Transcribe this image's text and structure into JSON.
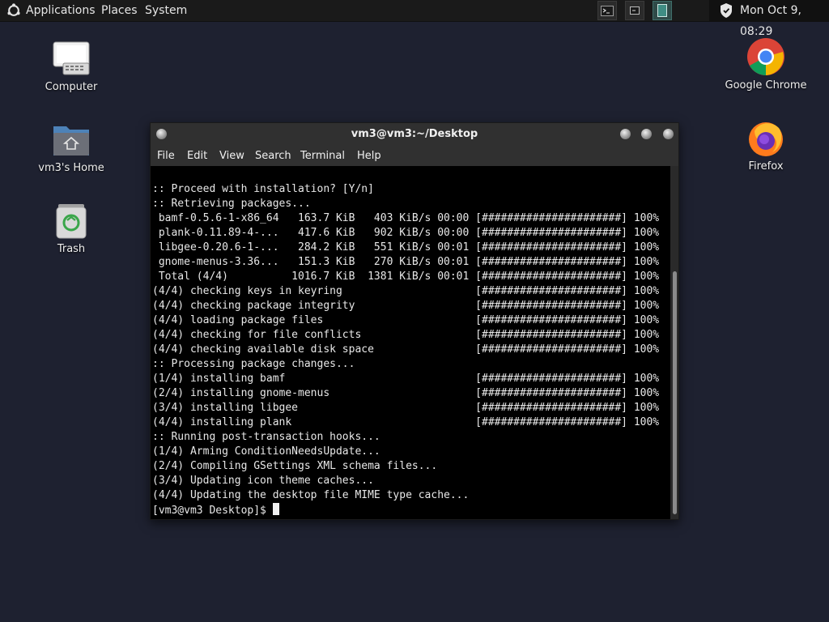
{
  "panel": {
    "applications": "Applications",
    "places": "Places",
    "system": "System",
    "clock": "Mon Oct  9, 08:29"
  },
  "desktop_icons": {
    "computer": "Computer",
    "home": "vm3's Home",
    "trash": "Trash",
    "chrome": "Google Chrome",
    "firefox": "Firefox"
  },
  "terminal": {
    "title": "vm3@vm3:~/Desktop",
    "menu": {
      "file": "File",
      "edit": "Edit",
      "view": "View",
      "search": "Search",
      "terminal": "Terminal",
      "help": "Help"
    },
    "lines": [
      ":: Proceed with installation? [Y/n]",
      ":: Retrieving packages...",
      " bamf-0.5.6-1-x86_64   163.7 KiB   403 KiB/s 00:00 [######################] 100%",
      " plank-0.11.89-4-...   417.6 KiB   902 KiB/s 00:00 [######################] 100%",
      " libgee-0.20.6-1-...   284.2 KiB   551 KiB/s 00:01 [######################] 100%",
      " gnome-menus-3.36...   151.3 KiB   270 KiB/s 00:01 [######################] 100%",
      " Total (4/4)          1016.7 KiB  1381 KiB/s 00:01 [######################] 100%",
      "(4/4) checking keys in keyring                     [######################] 100%",
      "(4/4) checking package integrity                   [######################] 100%",
      "(4/4) loading package files                        [######################] 100%",
      "(4/4) checking for file conflicts                  [######################] 100%",
      "(4/4) checking available disk space                [######################] 100%",
      ":: Processing package changes...",
      "(1/4) installing bamf                              [######################] 100%",
      "(2/4) installing gnome-menus                       [######################] 100%",
      "(3/4) installing libgee                            [######################] 100%",
      "(4/4) installing plank                             [######################] 100%",
      ":: Running post-transaction hooks...",
      "(1/4) Arming ConditionNeedsUpdate...",
      "(2/4) Compiling GSettings XML schema files...",
      "(3/4) Updating icon theme caches...",
      "(4/4) Updating the desktop file MIME type cache..."
    ],
    "prompt": "[vm3@vm3 Desktop]$ "
  }
}
